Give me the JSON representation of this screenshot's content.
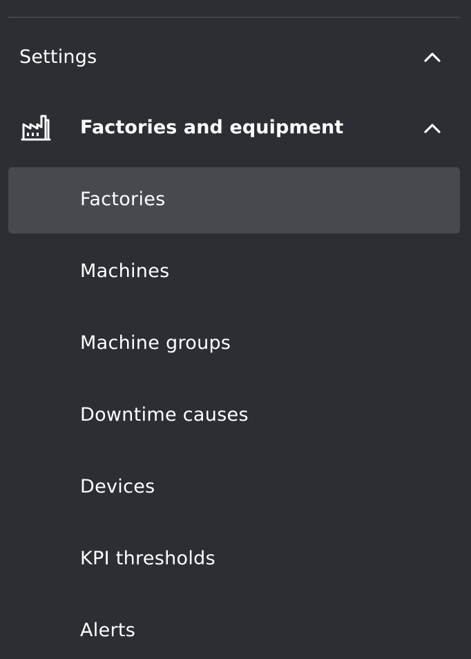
{
  "settings": {
    "title": "Settings",
    "chevron_icon": "chevron-up-icon",
    "expanded": true
  },
  "group": {
    "title": "Factories and equipment",
    "icon": "factory-icon",
    "chevron_icon": "chevron-up-icon",
    "expanded": true
  },
  "menu": {
    "items": [
      {
        "label": "Factories",
        "active": true
      },
      {
        "label": "Machines",
        "active": false
      },
      {
        "label": "Machine groups",
        "active": false
      },
      {
        "label": "Downtime causes",
        "active": false
      },
      {
        "label": "Devices",
        "active": false
      },
      {
        "label": "KPI thresholds",
        "active": false
      },
      {
        "label": "Alerts",
        "active": false
      }
    ]
  },
  "colors": {
    "background": "#2b2e33",
    "active_item": "#47494f",
    "divider": "#41454b",
    "text": "#ffffff"
  }
}
